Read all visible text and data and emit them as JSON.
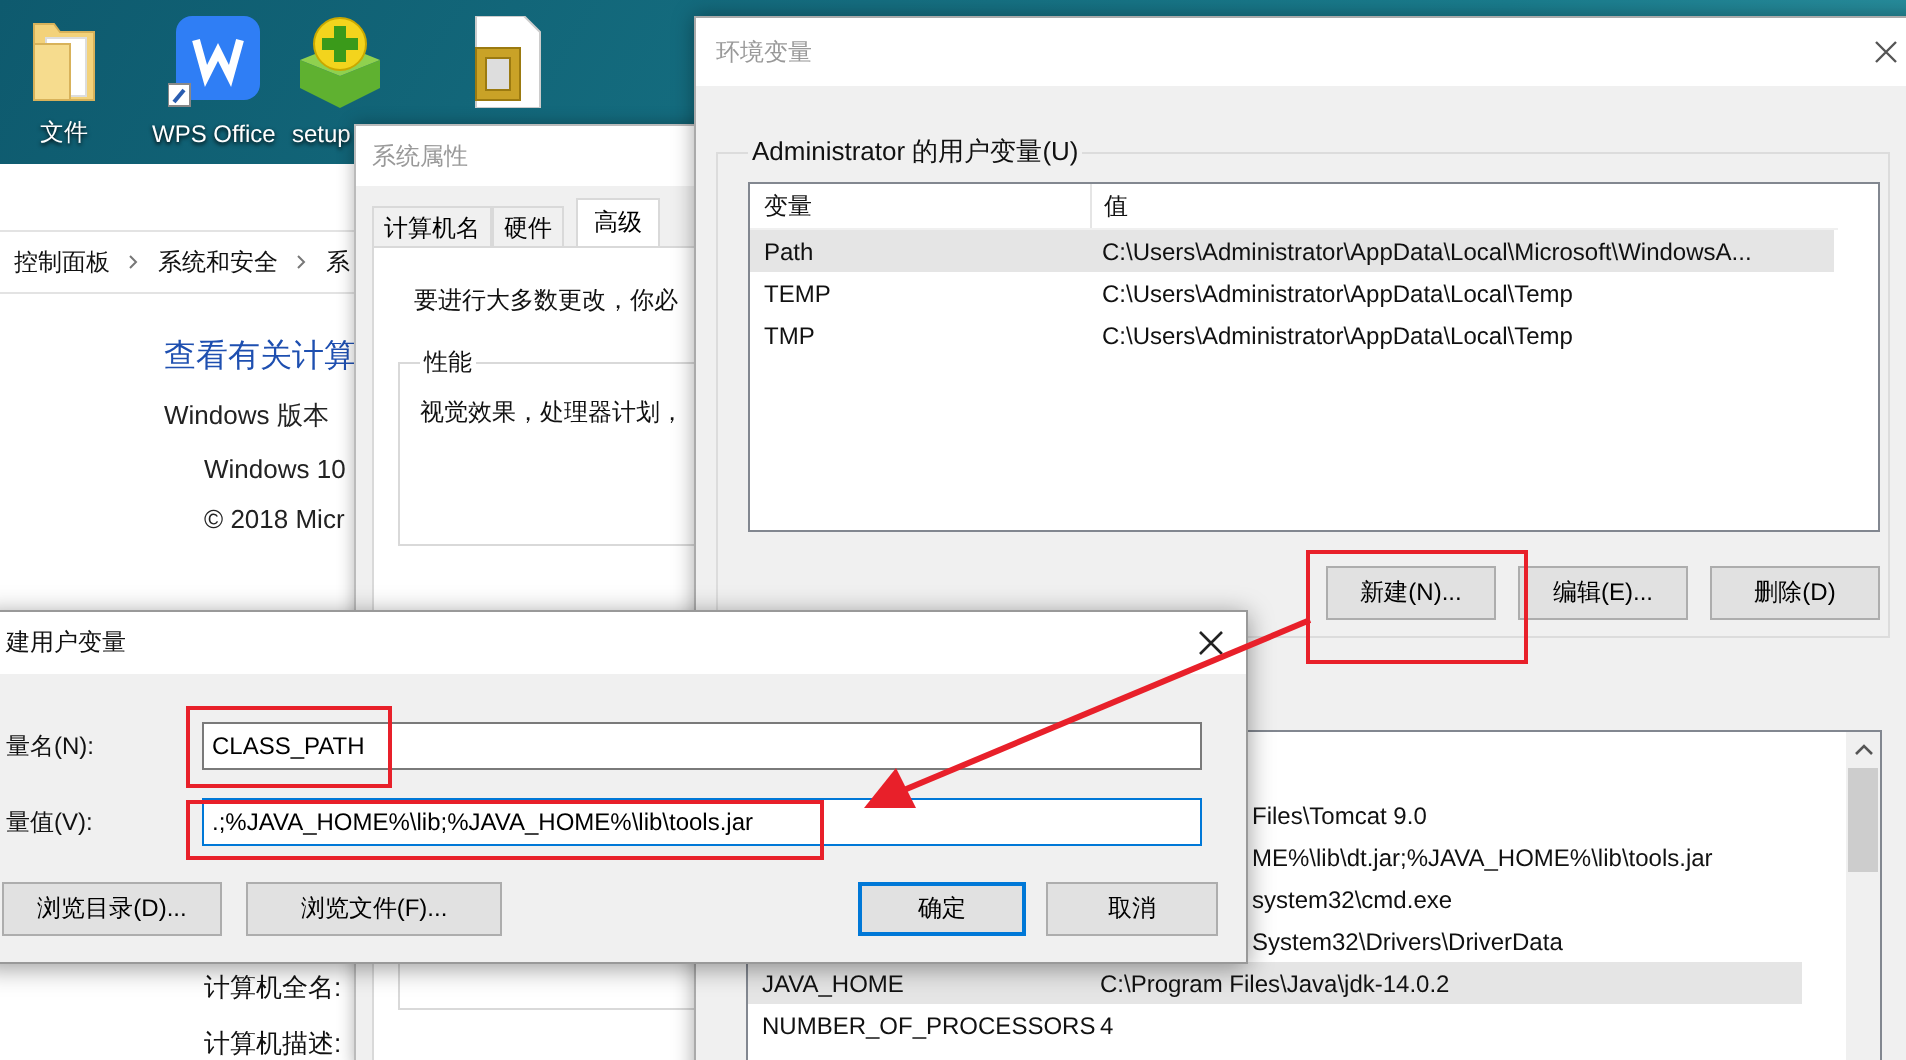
{
  "desktop_icons": [
    {
      "kind": "folder",
      "label": "文件"
    },
    {
      "kind": "wps",
      "label": "WPS Office"
    },
    {
      "kind": "setup",
      "label": "setup"
    },
    {
      "kind": "document"
    }
  ],
  "control_panel": {
    "breadcrumb": [
      "控制面板",
      "系统和安全",
      "系"
    ],
    "heading": "查看有关计算",
    "section": "Windows 版本",
    "edition": "Windows 10",
    "copyright": "© 2018 Micr",
    "fields": [
      "计算机全名:",
      "计算机描述:"
    ]
  },
  "system_properties": {
    "title": "系统属性",
    "tabs": [
      {
        "label": "计算机名",
        "selected": false
      },
      {
        "label": "硬件",
        "selected": false
      },
      {
        "label": "高级",
        "selected": true
      }
    ],
    "notice": "要进行大多数更改，你必",
    "group": {
      "label": "性能",
      "text": "视觉效果，处理器计划，"
    }
  },
  "environment_variables": {
    "title": "环境变量",
    "user_variables": {
      "label": "Administrator 的用户变量(U)",
      "columns": [
        "变量",
        "值"
      ],
      "rows": [
        {
          "name": "Path",
          "value": "C:\\Users\\Administrator\\AppData\\Local\\Microsoft\\WindowsA...",
          "selected": true
        },
        {
          "name": "TEMP",
          "value": "C:\\Users\\Administrator\\AppData\\Local\\Temp",
          "selected": false
        },
        {
          "name": "TMP",
          "value": "C:\\Users\\Administrator\\AppData\\Local\\Temp",
          "selected": false
        }
      ]
    },
    "buttons": [
      "新建(N)...",
      "编辑(E)...",
      "删除(D)"
    ],
    "system_variables": {
      "rows": [
        {
          "value": "Files\\Tomcat 9.0",
          "selected": false
        },
        {
          "value": "ME%\\lib\\dt.jar;%JAVA_HOME%\\lib\\tools.jar",
          "selected": false
        },
        {
          "value": "system32\\cmd.exe",
          "selected": false
        },
        {
          "value": "System32\\Drivers\\DriverData",
          "selected": false
        },
        {
          "name": "JAVA_HOME",
          "value": "C:\\Program Files\\Java\\jdk-14.0.2",
          "selected": true
        },
        {
          "name": "NUMBER_OF_PROCESSORS",
          "value": "4",
          "selected": false
        }
      ]
    }
  },
  "new_variable_dialog": {
    "title": "建用户变量",
    "fields": [
      {
        "label": "量名(N):",
        "value": "CLASS_PATH",
        "focused": false
      },
      {
        "label": "量值(V):",
        "value": ".;%JAVA_HOME%\\lib;%JAVA_HOME%\\lib\\tools.jar",
        "focused": true
      }
    ],
    "buttons": [
      {
        "label": "浏览目录(D)...",
        "default": false
      },
      {
        "label": "浏览文件(F)...",
        "default": false
      },
      {
        "label": "确定",
        "default": true
      },
      {
        "label": "取消",
        "default": false
      }
    ]
  }
}
